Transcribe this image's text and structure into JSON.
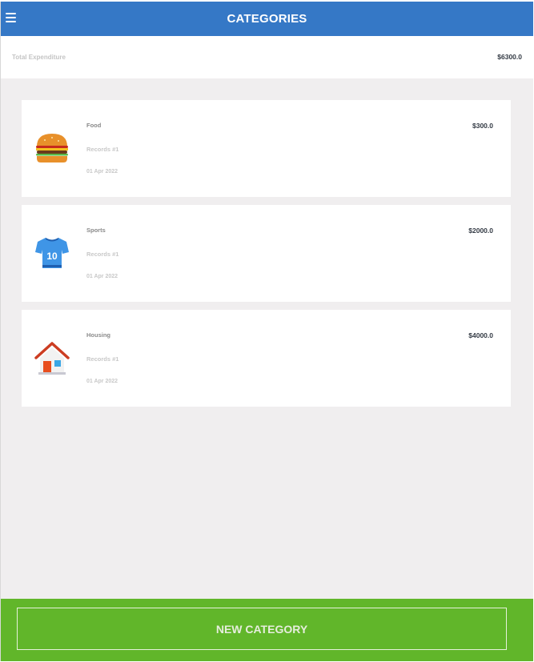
{
  "header": {
    "title": "CATEGORIES",
    "menu_icon": "hamburger-menu-icon"
  },
  "summary": {
    "label": "Total Expenditure",
    "value": "$6300.0"
  },
  "categories": [
    {
      "name": "Food",
      "records": "Records #1",
      "date": "01 Apr 2022",
      "amount": "$300.0",
      "icon": "burger-icon"
    },
    {
      "name": "Sports",
      "records": "Records #1",
      "date": "01 Apr 2022",
      "amount": "$2000.0",
      "icon": "jersey-icon",
      "icon_text": "10"
    },
    {
      "name": "Housing",
      "records": "Records #1",
      "date": "01 Apr 2022",
      "amount": "$4000.0",
      "icon": "house-icon"
    }
  ],
  "footer": {
    "button_label": "NEW CATEGORY"
  },
  "colors": {
    "header": "#3578c6",
    "footer": "#61b62a",
    "background": "#f0eeef"
  }
}
